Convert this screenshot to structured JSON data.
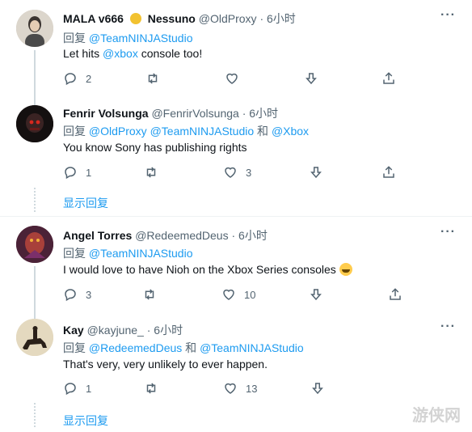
{
  "tweets": [
    {
      "name": "MALA v666",
      "name_emoji": "coin-emoji",
      "name2": "Nessuno",
      "handle": "@OldProxy",
      "time": "· 6小时",
      "reply_prefix": "回复",
      "reply_to": "@TeamNINJAStudio",
      "body_pre": "Let hits ",
      "body_link": "@xbox",
      "body_post": " console too!",
      "stats": {
        "replies": "2",
        "retweets": "",
        "likes": ""
      }
    },
    {
      "name": "Fenrir Volsunga",
      "handle": "@FenrirVolsunga",
      "time": "· 6小时",
      "reply_prefix": "回复",
      "reply_to": "@OldProxy @TeamNINJAStudio",
      "reply_and": " 和 ",
      "reply_to2": "@Xbox",
      "body": "You know Sony has publishing rights",
      "stats": {
        "replies": "1",
        "retweets": "",
        "likes": "3"
      }
    },
    {
      "name": "Angel Torres",
      "handle": "@RedeemedDeus",
      "time": "· 6小时",
      "reply_prefix": "回复",
      "reply_to": "@TeamNINJAStudio",
      "body": "I would love to have Nioh on the Xbox Series consoles ",
      "body_emoji": "grinning-face-emoji",
      "stats": {
        "replies": "3",
        "retweets": "",
        "likes": "10"
      }
    },
    {
      "name": "Kay",
      "handle": "@kayjune_",
      "time": "· 6小时",
      "reply_prefix": "回复",
      "reply_to": "@RedeemedDeus",
      "reply_and": " 和 ",
      "reply_to2": "@TeamNINJAStudio",
      "body": "That's very, very unlikely to ever happen.",
      "stats": {
        "replies": "1",
        "retweets": "",
        "likes": "13"
      }
    }
  ],
  "show_replies": "显示回复",
  "more_glyph": "···",
  "colors": {
    "link": "#1d9bf0",
    "muted": "#536471",
    "text": "#0f1419"
  },
  "watermark_text": "游侠网"
}
